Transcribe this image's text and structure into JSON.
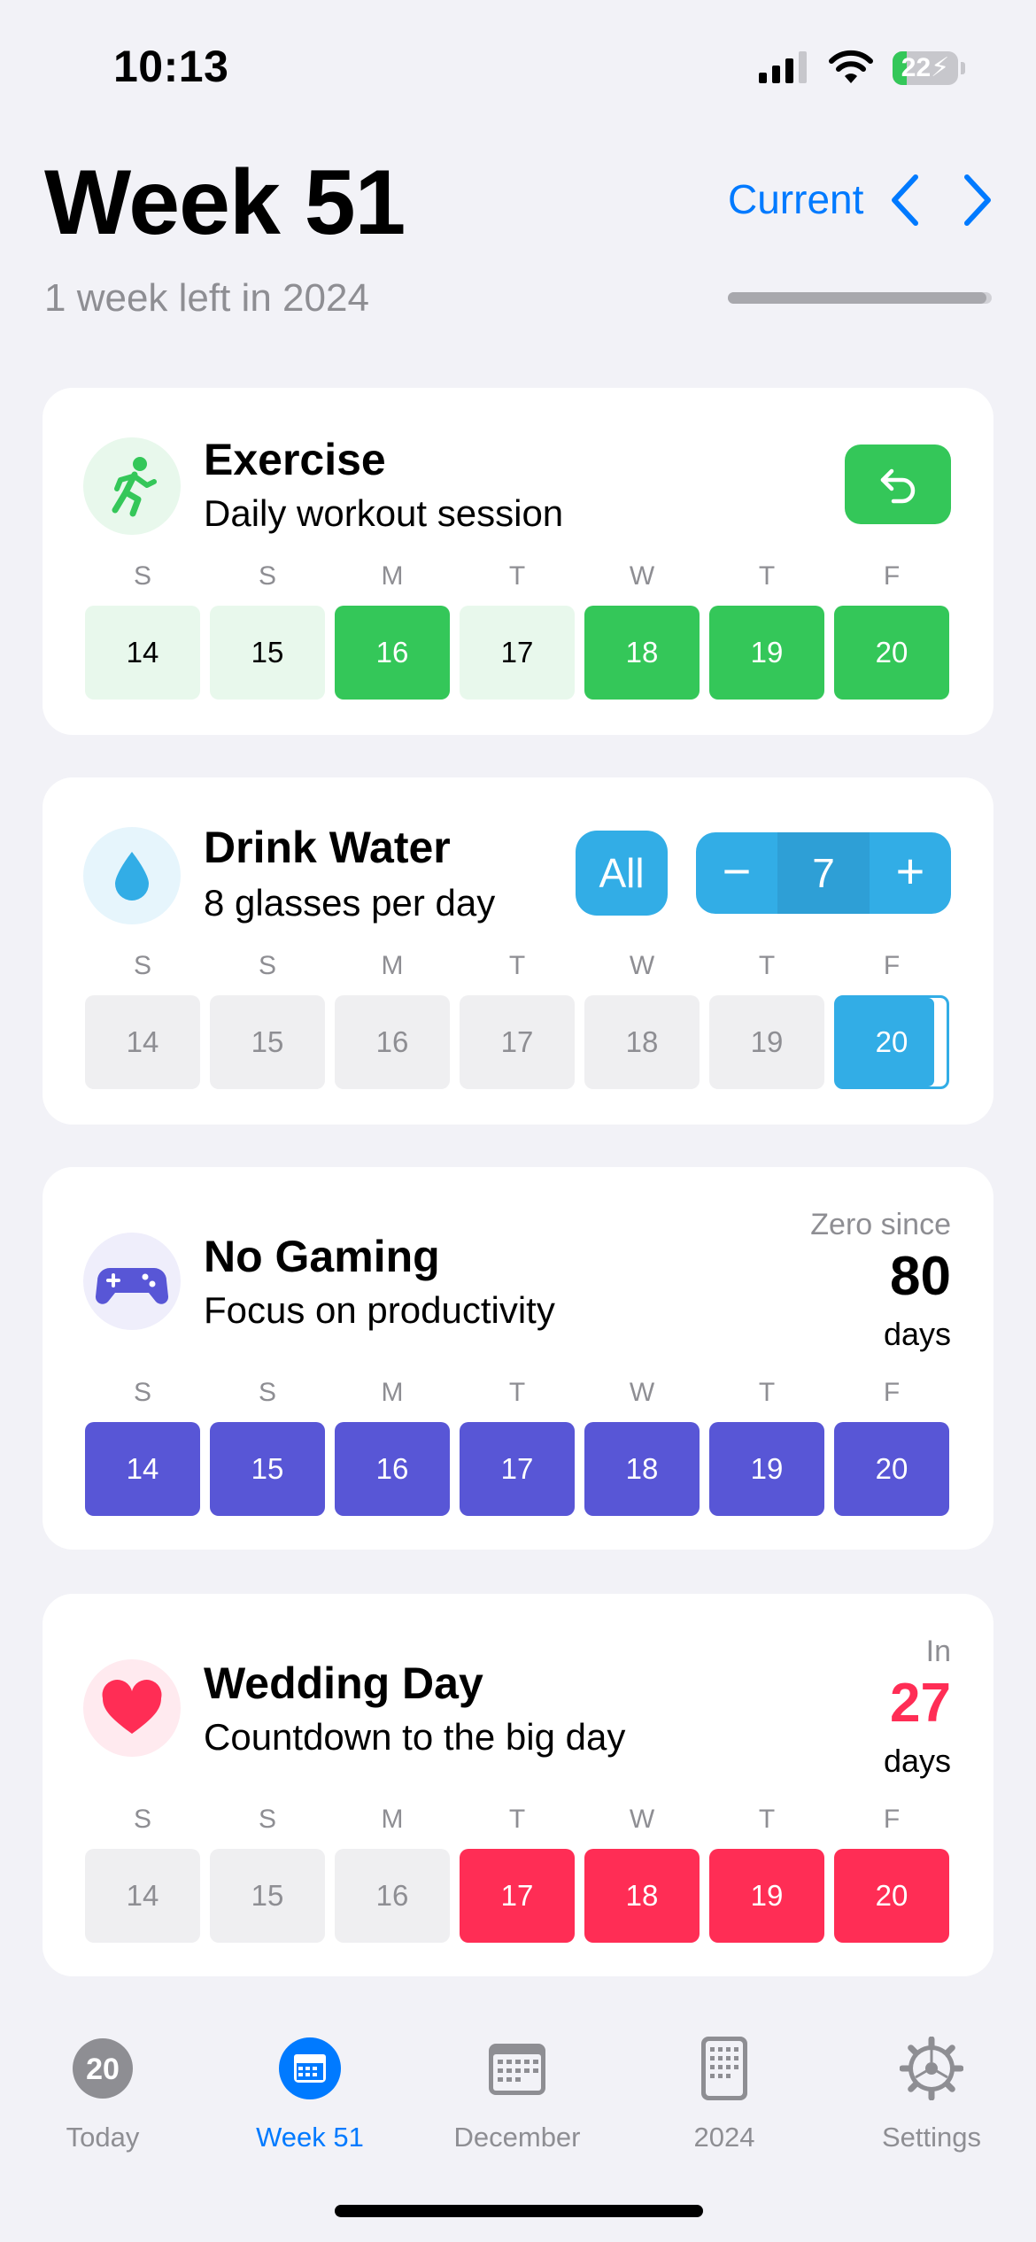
{
  "status_bar": {
    "time": "10:13",
    "battery_percent": "22",
    "battery_level": 0.22
  },
  "header": {
    "title": "Week 51",
    "subtitle": "1 week left in 2024",
    "current_label": "Current",
    "year_progress": 0.98
  },
  "day_letters": [
    "S",
    "S",
    "M",
    "T",
    "W",
    "T",
    "F"
  ],
  "day_numbers": [
    "14",
    "15",
    "16",
    "17",
    "18",
    "19",
    "20"
  ],
  "habits": [
    {
      "title": "Exercise",
      "description": "Daily workout session",
      "color": "#34c759",
      "icon": "running-figure-icon",
      "completed": [
        false,
        false,
        true,
        false,
        true,
        true,
        true
      ]
    },
    {
      "title": "Drink Water",
      "description": "8 glasses per day",
      "color": "#32ade6",
      "icon": "water-drop-icon",
      "all_label": "All",
      "stepper_value": "7",
      "stepper_minus": "−",
      "stepper_plus": "+",
      "completed": [
        false,
        false,
        false,
        false,
        false,
        false,
        true
      ]
    },
    {
      "title": "No Gaming",
      "description": "Focus on productivity",
      "color": "#5856d6",
      "icon": "game-controller-icon",
      "stat_caption": "Zero since",
      "stat_number": "80",
      "stat_unit": "days",
      "completed": [
        true,
        true,
        true,
        true,
        true,
        true,
        true
      ]
    },
    {
      "title": "Wedding Day",
      "description": "Countdown to the big day",
      "color": "#ff2d55",
      "icon": "heart-icon",
      "stat_caption": "In",
      "stat_number": "27",
      "stat_unit": "days",
      "completed": [
        false,
        false,
        false,
        true,
        true,
        true,
        true
      ]
    }
  ],
  "tab_bar": {
    "tabs": [
      {
        "label": "Today",
        "badge": "20",
        "icon": "today-badge-icon",
        "active": false
      },
      {
        "label": "Week 51",
        "icon": "week-calendar-icon",
        "active": true
      },
      {
        "label": "December",
        "icon": "month-calendar-icon",
        "active": false
      },
      {
        "label": "2024",
        "icon": "year-grid-icon",
        "active": false
      },
      {
        "label": "Settings",
        "icon": "gear-icon",
        "active": false
      }
    ]
  }
}
